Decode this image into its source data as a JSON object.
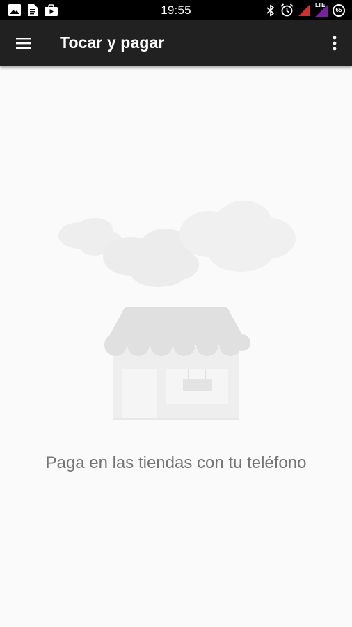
{
  "status_bar": {
    "time": "19:55",
    "left_icons": [
      "image-icon",
      "sim-card-icon",
      "shopping-bag-icon"
    ],
    "right_icons": [
      "bluetooth-icon",
      "alarm-icon",
      "cellular-signal-icon",
      "lte-signal-icon",
      "battery-icon"
    ],
    "network_label": "LTE",
    "battery_level": "65",
    "signal_colors": [
      "#d32f2f",
      "#7b1fa2"
    ]
  },
  "app_bar": {
    "title": "Tocar y pagar",
    "menu_icon": "hamburger-menu-icon",
    "overflow_icon": "more-vert-icon",
    "background": "#212121"
  },
  "main": {
    "illustration": "store-with-clouds-illustration",
    "message": "Paga en las tiendas con tu teléfono"
  }
}
